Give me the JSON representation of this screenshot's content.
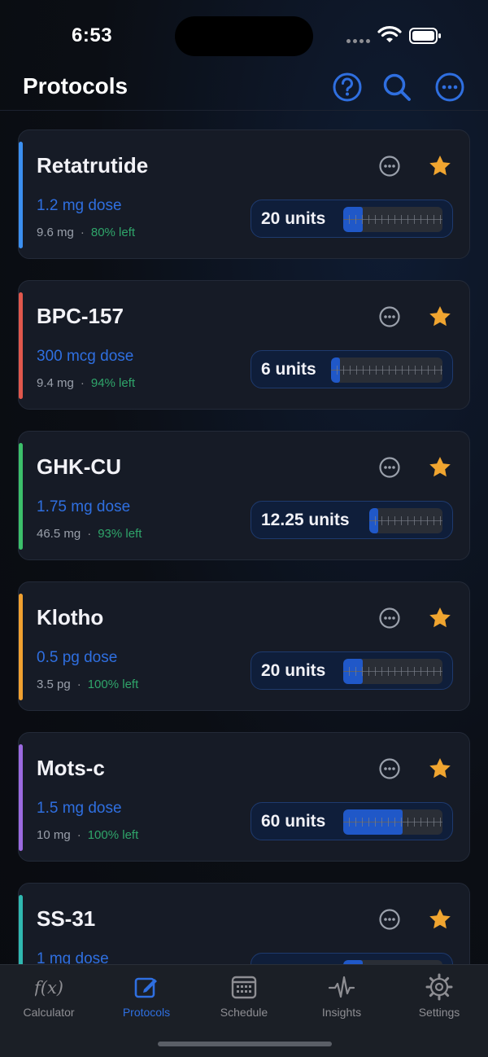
{
  "status": {
    "time": "6:53"
  },
  "header": {
    "title": "Protocols",
    "help_icon": "question-circle-icon",
    "search_icon": "search-icon",
    "more_icon": "ellipsis-circle-icon"
  },
  "colors": {
    "accent": "#2f6fe0",
    "remaining": "#2fa56a",
    "star": "#f0a530",
    "card": "#161b26"
  },
  "protocols": [
    {
      "name": "Retatrutide",
      "dose": "1.2 mg dose",
      "amount": "9.6 mg",
      "left": "80% left",
      "units": "20 units",
      "fill": 0.2,
      "color": "#3b8ff0"
    },
    {
      "name": "BPC-157",
      "dose": "300 mcg dose",
      "amount": "9.4 mg",
      "left": "94% left",
      "units": "6 units",
      "fill": 0.06,
      "color": "#e0574c"
    },
    {
      "name": "GHK-CU",
      "dose": "1.75 mg dose",
      "amount": "46.5 mg",
      "left": "93% left",
      "units": "12.25 units",
      "fill": 0.1225,
      "color": "#3cbf6a"
    },
    {
      "name": "Klotho",
      "dose": "0.5 pg dose",
      "amount": "3.5 pg",
      "left": "100% left",
      "units": "20 units",
      "fill": 0.2,
      "color": "#f0a030"
    },
    {
      "name": "Mots-c",
      "dose": "1.5 mg dose",
      "amount": "10 mg",
      "left": "100% left",
      "units": "60 units",
      "fill": 0.6,
      "color": "#9b6ae0"
    },
    {
      "name": "SS-31",
      "dose": "1 mg dose",
      "amount": "",
      "left": "",
      "units": "",
      "fill": 0.2,
      "color": "#2fb8b0"
    }
  ],
  "tabs": [
    {
      "label": "Calculator",
      "icon": "function-icon",
      "active": false
    },
    {
      "label": "Protocols",
      "icon": "edit-square-icon",
      "active": true
    },
    {
      "label": "Schedule",
      "icon": "calendar-icon",
      "active": false
    },
    {
      "label": "Insights",
      "icon": "waveform-icon",
      "active": false
    },
    {
      "label": "Settings",
      "icon": "gear-icon",
      "active": false
    }
  ]
}
